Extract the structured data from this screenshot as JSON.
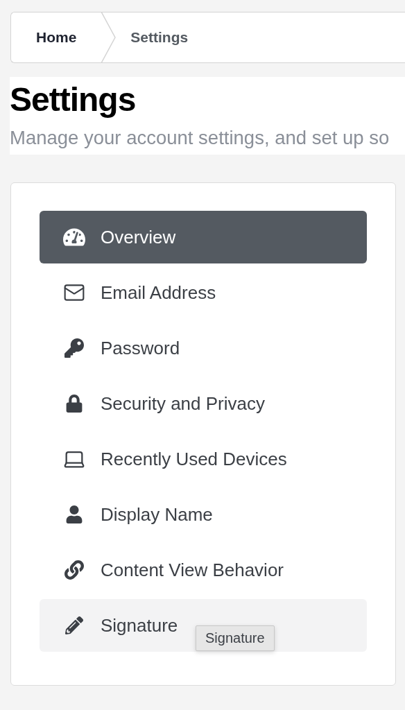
{
  "breadcrumb": [
    {
      "label": "Home",
      "current": false
    },
    {
      "label": "Settings",
      "current": true
    }
  ],
  "page": {
    "title": "Settings",
    "subtitle": "Manage your account settings, and set up so"
  },
  "nav": [
    {
      "label": "Overview",
      "selected": true,
      "hovered": false
    },
    {
      "label": "Email Address",
      "selected": false,
      "hovered": false
    },
    {
      "label": "Password",
      "selected": false,
      "hovered": false
    },
    {
      "label": "Security and Privacy",
      "selected": false,
      "hovered": false
    },
    {
      "label": "Recently Used Devices",
      "selected": false,
      "hovered": false
    },
    {
      "label": "Display Name",
      "selected": false,
      "hovered": false
    },
    {
      "label": "Content View Behavior",
      "selected": false,
      "hovered": false
    },
    {
      "label": "Signature",
      "selected": false,
      "hovered": true
    }
  ],
  "tooltip": {
    "text": "Signature"
  }
}
